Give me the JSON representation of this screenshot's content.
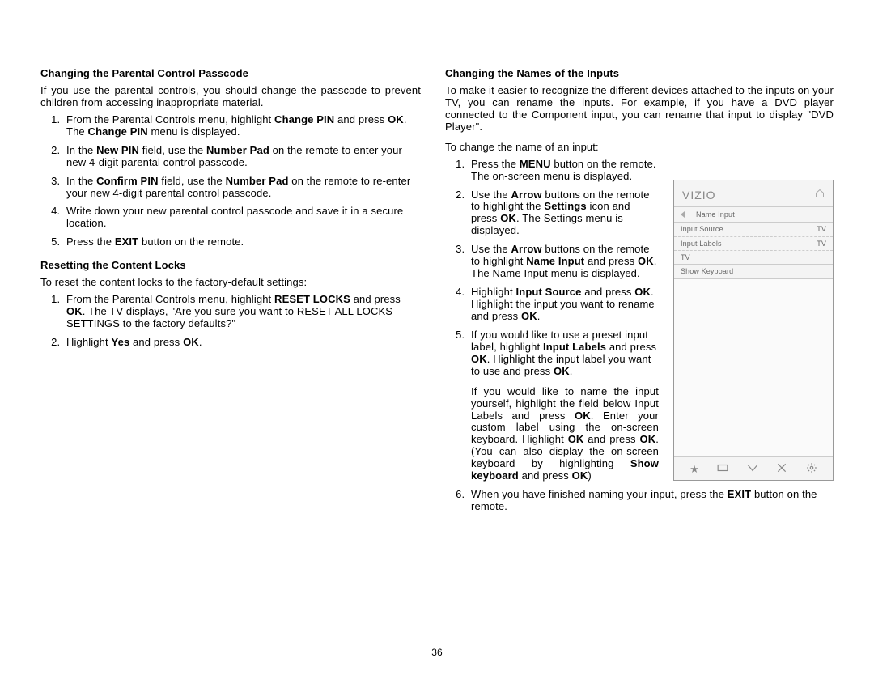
{
  "left": {
    "h1": "Changing the Parental Control Passcode",
    "p1": "If you use the parental controls, you should change the passcode to prevent children from accessing inappropriate material.",
    "li1a": "From the Parental Controls menu, highlight ",
    "li1b": "Change PIN",
    "li1c": " and press ",
    "li1d": "OK",
    "li1e": ". The ",
    "li1f": "Change PIN",
    "li1g": " menu is displayed.",
    "li2a": "In the ",
    "li2b": "New PIN",
    "li2c": " field, use the ",
    "li2d": "Number Pad",
    "li2e": " on the remote to enter your new 4-digit parental control passcode.",
    "li3a": "In the ",
    "li3b": "Confirm PIN",
    "li3c": " field, use the ",
    "li3d": "Number Pad",
    "li3e": " on the remote to re-enter your new 4-digit parental control passcode.",
    "li4": "Write down your new parental control passcode and save it in a secure location.",
    "li5a": "Press the ",
    "li5b": "EXIT",
    "li5c": " button on the remote.",
    "h2": "Resetting the Content Locks",
    "p2": "To reset the content locks to the factory-default settings:",
    "r1a": "From the Parental Controls menu, highlight ",
    "r1b": "RESET LOCKS",
    "r1c": " and press ",
    "r1d": "OK",
    "r1e": ". The TV displays, \"Are you sure you want to RESET ALL LOCKS SETTINGS to the factory defaults?\"",
    "r2a": "Highlight ",
    "r2b": "Yes",
    "r2c": " and press ",
    "r2d": "OK",
    "r2e": "."
  },
  "right": {
    "h1": "Changing the Names of the Inputs",
    "p1": "To make it easier to recognize the different devices attached to the inputs on your TV, you can rename the inputs. For example, if you have a DVD player connected to the Component input, you can rename that input to display \"DVD Player\".",
    "p2": "To change the name of an input:",
    "li1a": "Press the ",
    "li1b": "MENU",
    "li1c": " button on the remote. The on-screen menu is displayed.",
    "li2a": "Use the ",
    "li2b": "Arrow",
    "li2c": " buttons on the remote to highlight the ",
    "li2d": "Settings",
    "li2e": " icon and press ",
    "li2f": "OK",
    "li2g": ". The Settings menu is displayed.",
    "li3a": "Use the ",
    "li3b": "Arrow",
    "li3c": " buttons on the remote to highlight ",
    "li3d": "Name Input",
    "li3e": " and press ",
    "li3f": "OK",
    "li3g": ". The Name Input menu is displayed.",
    "li4a": "Highlight ",
    "li4b": "Input Source",
    "li4c": " and press ",
    "li4d": "OK",
    "li4e": ". Highlight the input you want to rename and press ",
    "li4f": "OK",
    "li4g": ".",
    "li5a": "If you would like to use a preset input label, highlight ",
    "li5b": "Input Labels",
    "li5c": " and press ",
    "li5d": "OK",
    "li5e": ". Highlight the input label you want to use and press ",
    "li5f": "OK",
    "li5g": ".",
    "li5pa": "If you would like to name the input yourself, highlight the field below Input Labels and press ",
    "li5pb": "OK",
    "li5pc": ". Enter your custom label using the on-screen keyboard. Highlight ",
    "li5pd": "OK",
    "li5pe": " and press ",
    "li5pf": "OK",
    "li5pg": ". (You can also display the on-screen keyboard by highlighting ",
    "li5ph": "Show keyboard",
    "li5pi": " and press ",
    "li5pj": "OK",
    "li5pk": ")",
    "li6a": "When you have finished naming your input, press the ",
    "li6b": "EXIT",
    "li6c": " button on the remote."
  },
  "figure": {
    "logo": "VIZIO",
    "breadcrumb": "Name Input",
    "row1l": "Input Source",
    "row1r": "TV",
    "row2l": "Input Labels",
    "row2r": "TV",
    "row3l": "TV",
    "row4l": "Show Keyboard"
  },
  "pagenum": "36"
}
